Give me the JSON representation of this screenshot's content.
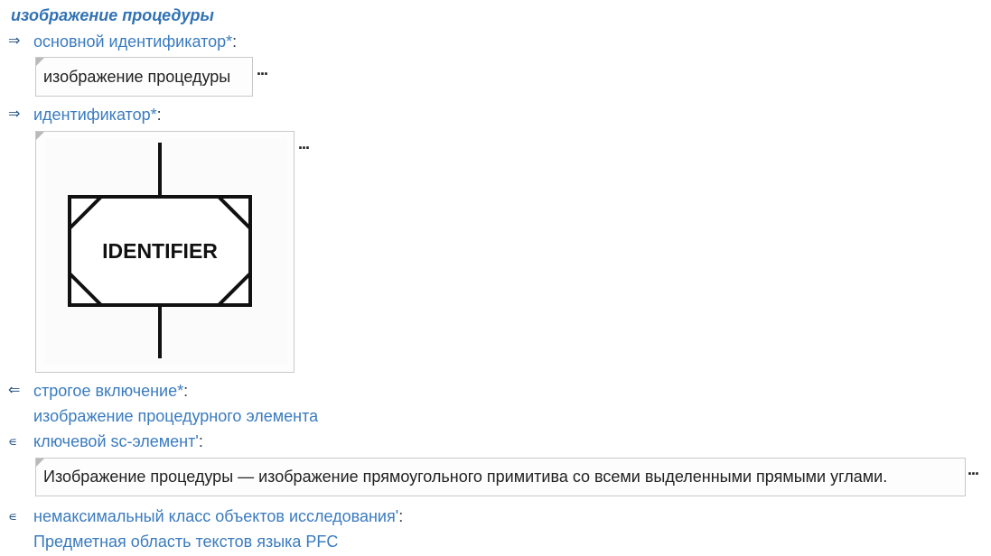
{
  "page": {
    "title": "изображение процедуры"
  },
  "relations": {
    "main_id": {
      "arrow": "⇒",
      "label": "основной идентификатор*",
      "colon": ":",
      "value": "изображение процедуры",
      "more": "..."
    },
    "identifier": {
      "arrow": "⇒",
      "label": "идентификатор*",
      "colon": ":",
      "image_text": "IDENTIFIER",
      "more": "..."
    },
    "strict_inclusion": {
      "arrow": "⇐",
      "label": "строгое включение*",
      "colon": ":",
      "value": "изображение процедурного элемента"
    },
    "key_element": {
      "arrow": "∊",
      "label": "ключевой sc-элемент'",
      "colon": ":",
      "value": "Изображение процедуры — изображение прямоугольного примитива со всеми выделенными прямыми углами.",
      "more": "..."
    },
    "non_max_class": {
      "arrow": "∊",
      "label": "немаксимальный класс объектов исследования'",
      "colon": ":",
      "value": "Предметная область текстов языка PFC"
    }
  }
}
